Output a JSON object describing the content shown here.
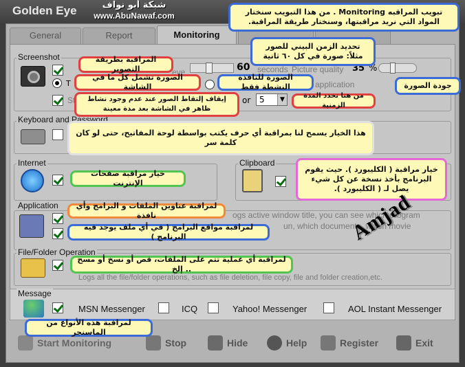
{
  "app": {
    "title": "Golden Eye"
  },
  "logo": {
    "arabic": "شبكة أبو نواف",
    "url": "www.AbuNawaf.com"
  },
  "tabs": [
    {
      "label": "General"
    },
    {
      "label": "Report"
    },
    {
      "label": "Monitoring"
    }
  ],
  "screenshot": {
    "title": "Screenshot",
    "seconds_value": "60",
    "seconds_label": "seconds",
    "quality_label": "Picture quality",
    "quality_value": "35",
    "quality_unit": "%",
    "option_t": "T",
    "option_active": "application",
    "stop_prefix": "St",
    "stop_or": "or",
    "stop_minutes": "5",
    "hidden_text": "eve"
  },
  "keyboard": {
    "title": "Keyboard and Password"
  },
  "internet": {
    "title": "Internet"
  },
  "clipboard": {
    "title": "Clipboard"
  },
  "application": {
    "title": "Application",
    "desc1": "ogs active window title, you can see which program",
    "desc2": "un, which documents, which movie"
  },
  "filefolder": {
    "title": "File/Folder Operation",
    "desc": "Logs all the file/folder operations, such as file deletion, file copy, file and folder creation,etc."
  },
  "message": {
    "title": "Message",
    "items": [
      {
        "label": "MSN Messenger",
        "checked": true
      },
      {
        "label": "ICQ",
        "checked": false
      },
      {
        "label": "Yahoo! Messenger",
        "checked": false
      },
      {
        "label": "AOL Instant Messenger",
        "checked": false
      }
    ]
  },
  "buttons": {
    "start": "Start Monitoring",
    "stop": "Stop",
    "hide": "Hide",
    "help": "Help",
    "register": "Register",
    "exit": "Exit"
  },
  "annotations": {
    "top": "تبويب المراقبه Monitoring . من هذا التبويب سنختار المواد التي نريد مراقبتها، وسنختار طريقة المراقبة.",
    "interval": "تحديد الزمن البيني للصور مثلاً: صورة في كل ٦٠ ثانية",
    "screenshot_method": "المراقبة بطريقة التصوير",
    "whole_screen": "الصورة تشمل كل ما في الشاشة",
    "active_window": "الصورة للنافذة النشطة فقط",
    "quality": "جودة الصورة",
    "stop_capture": "إيقاف إلتقاط الصور عند عدم وجود نشاط ظاهر في الشاشة بعد مدة معينة",
    "set_period": "من هنا نحدد المدة الزمنية",
    "keyboard": "هذا الخيار يسمح لنا بمراقبة أي حرف يكتب بواسطة لوحة المفاتيح، حتى لو كان كلمة سر",
    "internet": "خيار مراقبة صفحات الإنترنت",
    "clipboard": "خيار مراقبة ( الكليبورد ). حيث يقوم البرنامج بأخذ نسخة عن كل شيء يصل لـ ( الكليبورد ).",
    "app_titles": "لمراقبة عناوين الملفات و البرامج وأي نافذة",
    "app_locations": "لمراقبة مواقع البرامج ( في أي ملف يوجد فيه البرنامج )",
    "file_ops": "لمراقبة أي عملية تتم على الملفات، قص أو نسخ أو مسح .. إلخ",
    "messenger": "لمراقبة هذه الأنواع من الماسنجر"
  },
  "watermark": "Amjad",
  "colors": {
    "annot_red": "#e04040",
    "annot_blue": "#3b6bd6",
    "annot_green": "#52c452",
    "annot_pink": "#e26ad6",
    "annot_orange": "#f08a3a",
    "check_green": "#0a6d12"
  }
}
